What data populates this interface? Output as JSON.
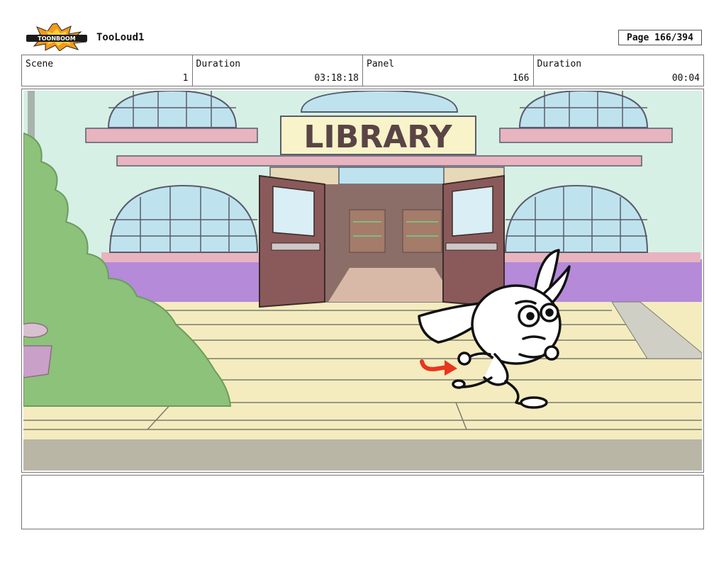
{
  "header": {
    "logo_text": "TOONBOOM",
    "project_title": "TooLoud1",
    "page_label": "Page 166/394"
  },
  "info": {
    "scene_label": "Scene",
    "scene_value": "1",
    "duration_label": "Duration",
    "duration_value": "03:18:18",
    "panel_label": "Panel",
    "panel_value": "166",
    "panel_duration_label": "Duration",
    "panel_duration_value": "00:04"
  },
  "panel": {
    "sign_text": "LIBRARY"
  },
  "colors": {
    "wall": "#d6f0e6",
    "purple_band": "#b48ad9",
    "steps": "#f4ecbf",
    "pink_trim": "#e7b4c0",
    "door": "#8a5a5a",
    "bush": "#8cc27a",
    "arrow": "#e8361f"
  },
  "notes": {}
}
